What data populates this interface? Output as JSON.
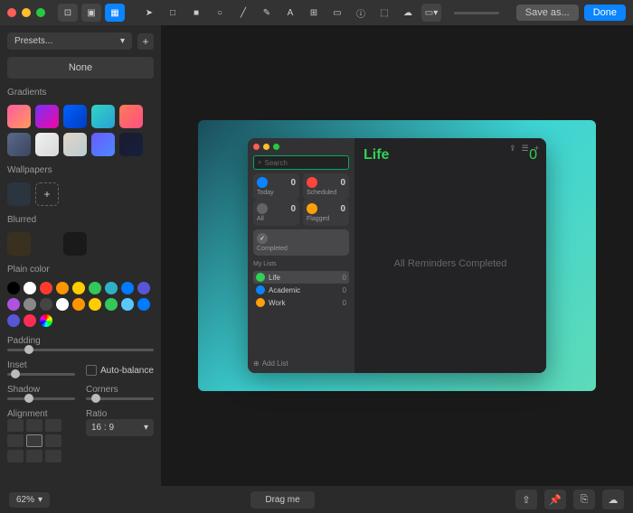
{
  "toolbar": {
    "save": "Save as...",
    "done": "Done"
  },
  "presets": {
    "label": "Presets...",
    "none": "None"
  },
  "sections": {
    "gradients": "Gradients",
    "wallpapers": "Wallpapers",
    "blurred": "Blurred",
    "plain": "Plain color",
    "padding": "Padding",
    "inset": "Inset",
    "autobalance": "Auto-balance",
    "shadow": "Shadow",
    "corners": "Corners",
    "alignment": "Alignment",
    "ratio": "Ratio"
  },
  "ratio": {
    "value": "16 : 9"
  },
  "gradients": [
    "linear-gradient(135deg,#ff5ca0,#ff9a5a)",
    "linear-gradient(135deg,#7b2ff7,#f107a3)",
    "linear-gradient(135deg,#0061ff,#003cbf)",
    "linear-gradient(135deg,#30d4c1,#2a9fd6)",
    "linear-gradient(135deg,#ff7a59,#ff4f81)",
    "linear-gradient(135deg,#5a6a8a,#3a4560)",
    "linear-gradient(135deg,#f0f0f0,#d8d8d8)",
    "linear-gradient(135deg,#e4d4c8,#b8cdd4)",
    "linear-gradient(135deg,#6a5aff,#4a8aff)",
    "linear-gradient(135deg,#1a1a2e,#16213e)"
  ],
  "blurred": [
    "#3a3020",
    "#2a2a2a",
    "#1a1a1a"
  ],
  "colors": [
    "#000",
    "#fff",
    "#ff3b30",
    "#ff9500",
    "#ffcc00",
    "#34c759",
    "#30b0c7",
    "#007aff",
    "#5856d6",
    "#af52de",
    "#888",
    "#444",
    "#fff",
    "#ff9500",
    "#ffcc00",
    "#34c759",
    "#5ac8fa",
    "#007aff",
    "#5856d6",
    "#ff2d55",
    "conic-gradient(red,yellow,lime,cyan,blue,magenta,red)"
  ],
  "app": {
    "search_ph": "Search",
    "title": "Life",
    "count": "0",
    "empty": "All Reminders Completed",
    "addlist": "Add List",
    "mylists": "My Lists",
    "cats": [
      {
        "label": "Today",
        "count": "0",
        "color": "#0a84ff"
      },
      {
        "label": "Scheduled",
        "count": "0",
        "color": "#ff453a"
      },
      {
        "label": "All",
        "count": "0",
        "color": "#636366"
      },
      {
        "label": "Flagged",
        "count": "0",
        "color": "#ff9f0a"
      }
    ],
    "completed": "Completed",
    "lists": [
      {
        "name": "Life",
        "count": "0",
        "color": "#30d158"
      },
      {
        "name": "Academic",
        "count": "0",
        "color": "#0a84ff"
      },
      {
        "name": "Work",
        "count": "0",
        "color": "#ff9f0a"
      }
    ]
  },
  "footer": {
    "zoom": "62%",
    "drag": "Drag me"
  }
}
